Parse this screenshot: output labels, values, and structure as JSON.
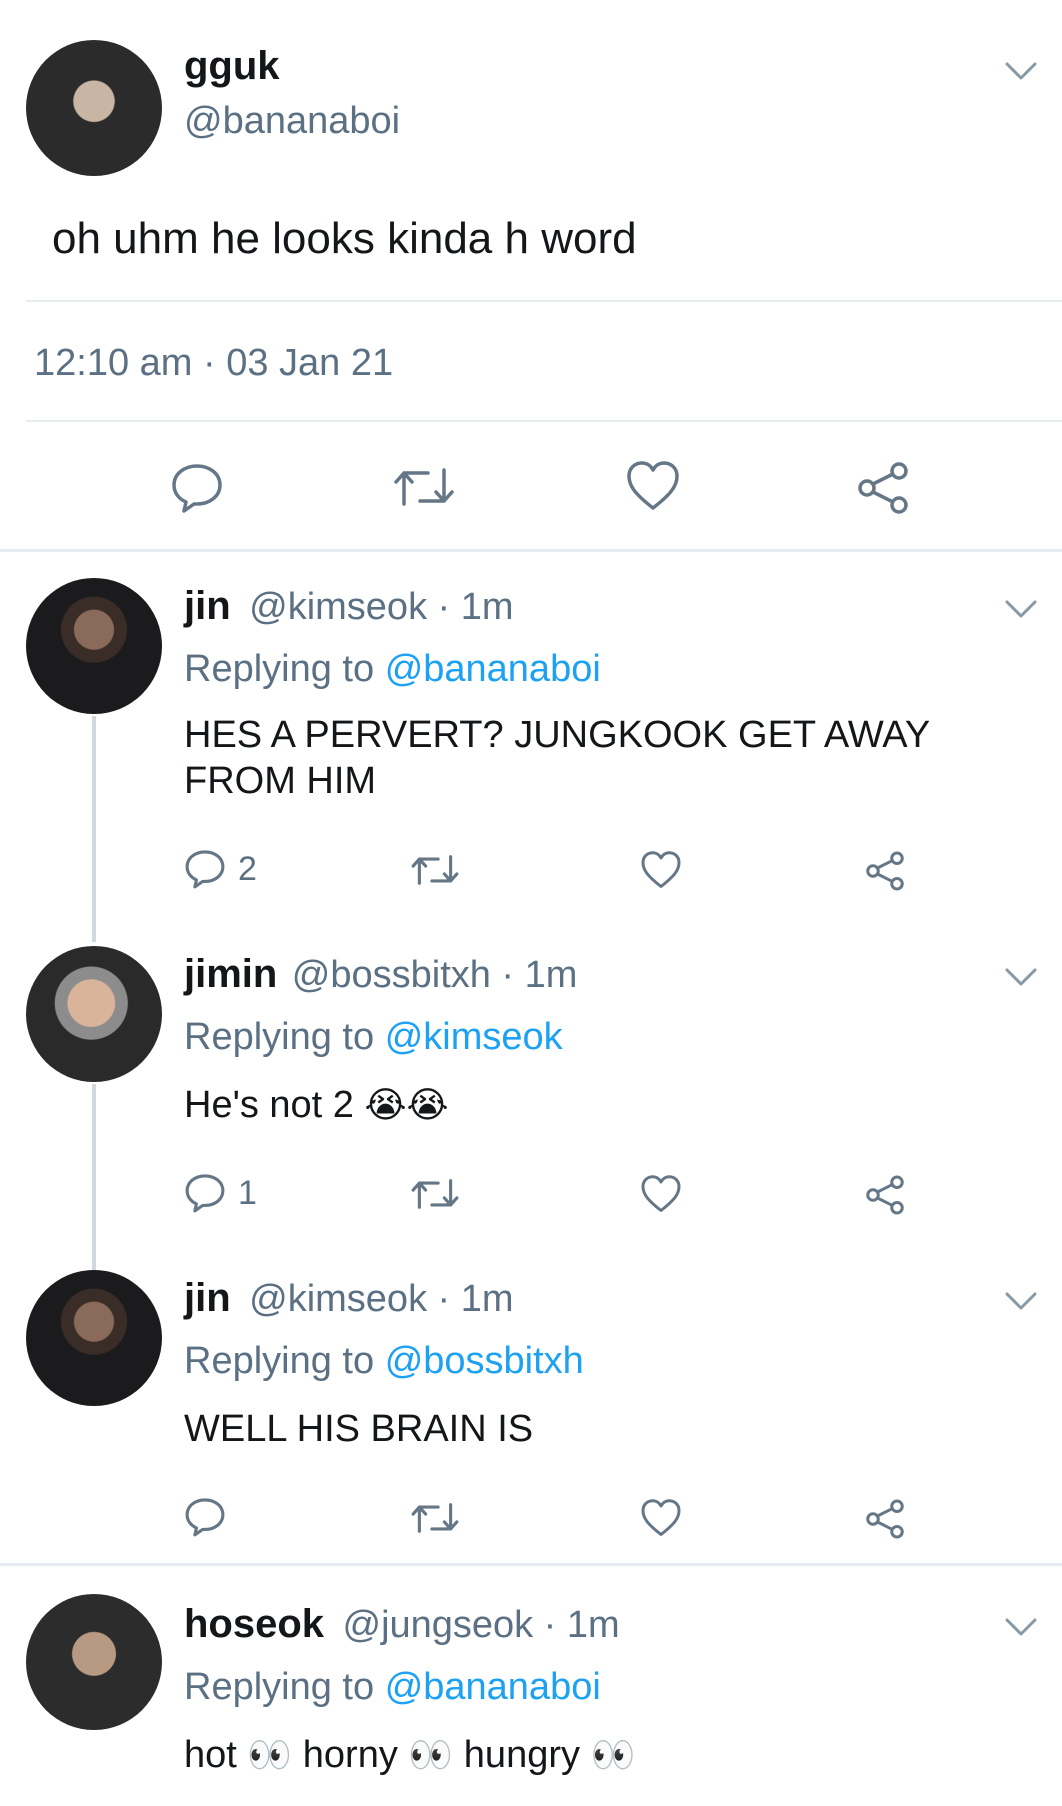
{
  "main_tweet": {
    "name": "gguk",
    "handle": "@bananaboi",
    "text": "oh uhm he looks kinda h word",
    "time": "12:10 am · 03 Jan 21"
  },
  "replies": [
    {
      "name": "jin",
      "handle": "@kimseok",
      "time": "· 1m",
      "replying_prefix": "Replying to",
      "replying_to": "@bananaboi",
      "text": "HES A PERVERT? JUNGKOOK GET AWAY FROM HIM",
      "reply_count": "2"
    },
    {
      "name": "jimin",
      "handle": "@bossbitxh",
      "time": "· 1m",
      "replying_prefix": "Replying to",
      "replying_to": "@kimseok",
      "text": "He's not 2",
      "emoji": "😭😭",
      "reply_count": "1"
    },
    {
      "name": "jin",
      "handle": "@kimseok",
      "time": "· 1m",
      "replying_prefix": "Replying to",
      "replying_to": "@bossbitxh",
      "text": "WELL HIS BRAIN IS",
      "reply_count": ""
    },
    {
      "name": "hoseok",
      "handle": "@jungseok",
      "time": "· 1m",
      "replying_prefix": "Replying to",
      "replying_to": "@bananaboi",
      "text_parts": [
        "hot",
        "horny",
        "hungry"
      ],
      "eyes_emoji": "👀"
    }
  ],
  "icons": [
    "chevron-down-icon",
    "reply-icon",
    "retweet-icon",
    "like-icon",
    "share-icon"
  ],
  "colors": {
    "text": "#14171a",
    "muted": "#5b7083",
    "link": "#1da1f2",
    "divider": "#e6ecf0"
  }
}
